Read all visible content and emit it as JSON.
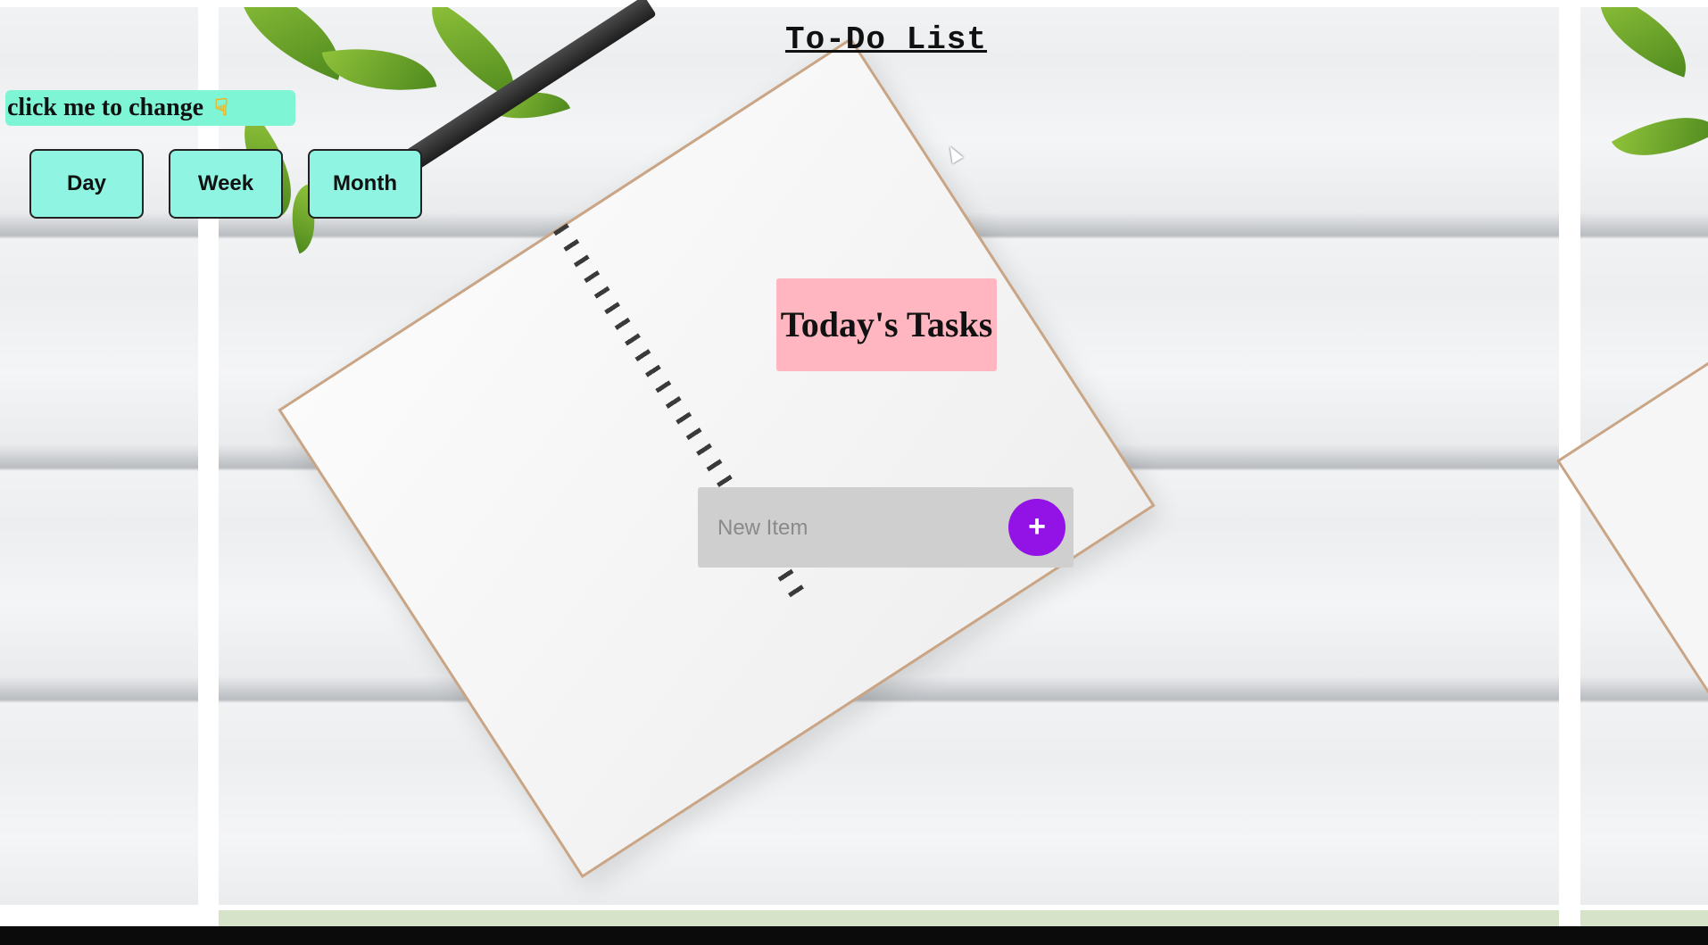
{
  "app": {
    "title": "To-Do List"
  },
  "view_switcher": {
    "hint_label": "click me to change",
    "hint_icon": "hand-pointing-down-icon",
    "buttons": [
      {
        "label": "Day"
      },
      {
        "label": "Week"
      },
      {
        "label": "Month"
      }
    ]
  },
  "list": {
    "heading": "Today's Tasks"
  },
  "new_item": {
    "placeholder": "New Item",
    "add_label": "+"
  },
  "colors": {
    "hint_bg": "#7ef5d4",
    "button_bg": "#8ff5e2",
    "heading_bg": "#ffb6c1",
    "add_button_bg": "#9313e6",
    "input_box_bg": "#cfcfcf"
  }
}
